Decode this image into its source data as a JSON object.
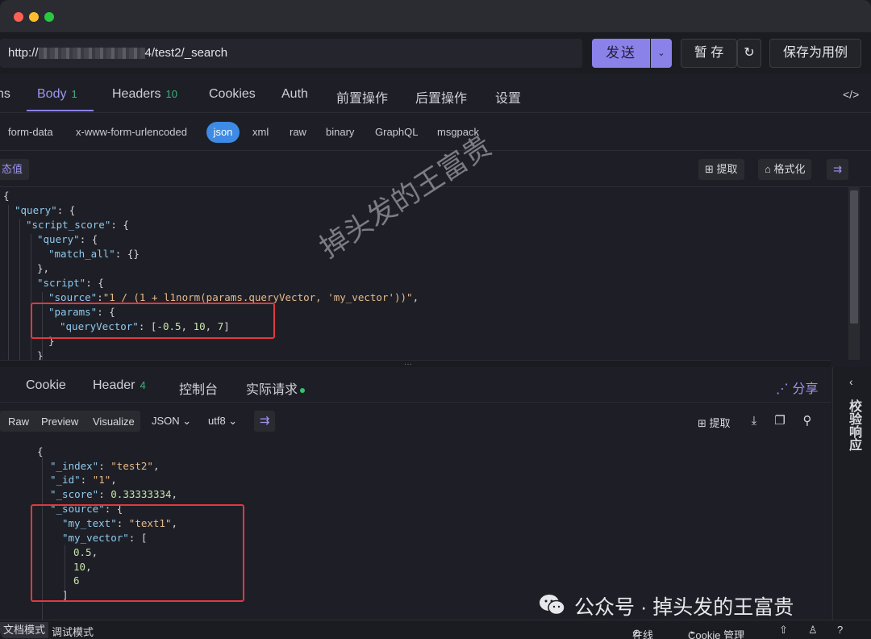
{
  "url": {
    "prefix": "http://",
    "suffix": "4/test2/_search"
  },
  "toolbar": {
    "send": "发送",
    "save_temp": "暂 存",
    "save_as_case": "保存为用例"
  },
  "request_tabs": [
    {
      "label": "ns",
      "count": ""
    },
    {
      "label": "Body",
      "count": "1"
    },
    {
      "label": "Headers",
      "count": "10"
    },
    {
      "label": "Cookies",
      "count": ""
    },
    {
      "label": "Auth",
      "count": ""
    },
    {
      "label": "前置操作",
      "count": ""
    },
    {
      "label": "后置操作",
      "count": ""
    },
    {
      "label": "设置",
      "count": ""
    }
  ],
  "body_types": [
    "form-data",
    "x-www-form-urlencoded",
    "json",
    "xml",
    "raw",
    "binary",
    "GraphQL",
    "msgpack"
  ],
  "body_toolbar": {
    "dynamic_value": "态值",
    "extract": "提取",
    "format": "格式化"
  },
  "response_tabs": [
    {
      "label": "Cookie",
      "count": ""
    },
    {
      "label": "Header",
      "count": "4"
    },
    {
      "label": "控制台",
      "count": ""
    },
    {
      "label": "实际请求",
      "count": ""
    }
  ],
  "share_label": "分享",
  "response_tools": {
    "raw": "Raw",
    "preview": "Preview",
    "visualize": "Visualize",
    "format": "JSON",
    "encoding": "utf8",
    "extract": "提取"
  },
  "side_panel": {
    "label": "校验响应"
  },
  "footer": {
    "doc_mode": "文档模式",
    "debug_mode": "调试模式",
    "online": "在线",
    "cookie_manage": "Cookie 管理"
  },
  "watermark": "掉头发的王富贵",
  "wechat_caption": "公众号 · 掉头发的王富贵",
  "colors": {
    "accent": "#8b82e9",
    "json_pill": "#3d8be4",
    "highlight_box": "#e0393f",
    "count_green": "#3fb37f"
  }
}
